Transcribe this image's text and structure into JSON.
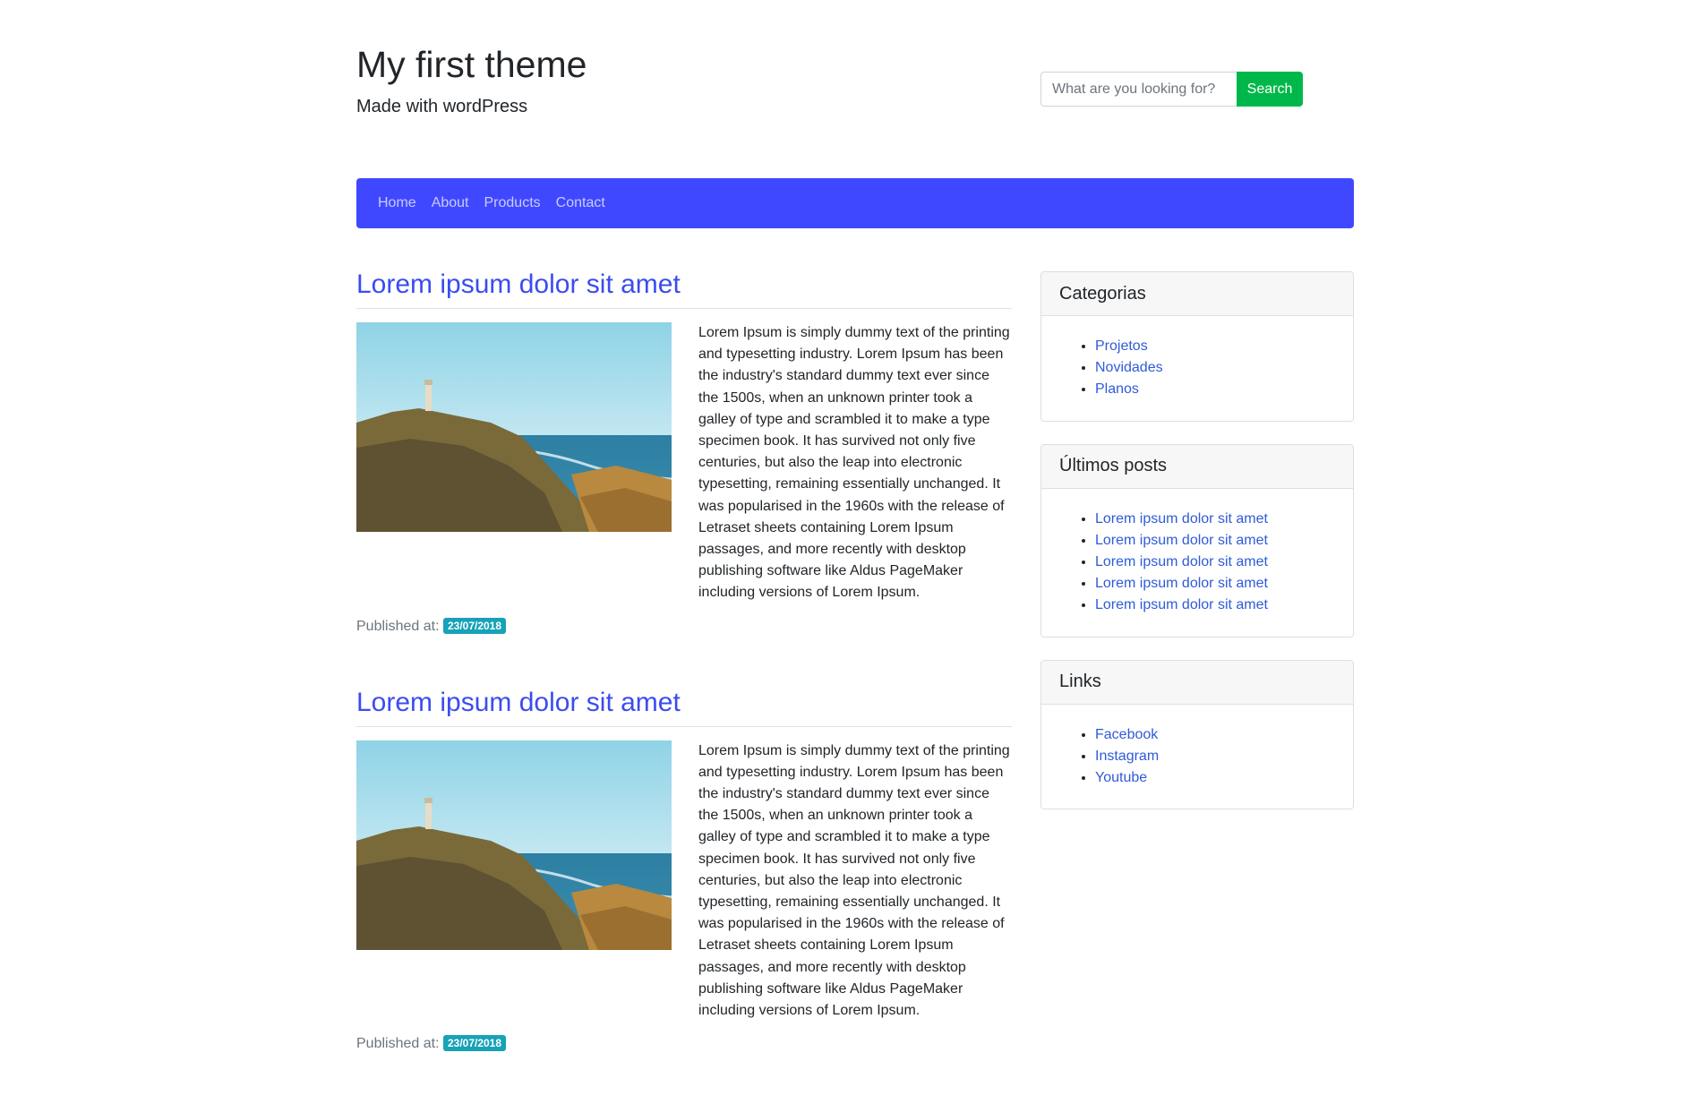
{
  "header": {
    "title": "My first theme",
    "subtitle": "Made with wordPress"
  },
  "search": {
    "placeholder": "What are you looking for?",
    "button_label": "Search"
  },
  "nav": {
    "items": [
      {
        "label": "Home"
      },
      {
        "label": "About"
      },
      {
        "label": "Products"
      },
      {
        "label": "Contact"
      }
    ]
  },
  "posts": [
    {
      "title": "Lorem ipsum dolor sit amet",
      "body": "Lorem Ipsum is simply dummy text of the printing and typesetting industry. Lorem Ipsum has been the industry's standard dummy text ever since the 1500s, when an unknown printer took a galley of type and scrambled it to make a type specimen book. It has survived not only five centuries, but also the leap into electronic typesetting, remaining essentially unchanged. It was popularised in the 1960s with the release of Letraset sheets containing Lorem Ipsum passages, and more recently with desktop publishing software like Aldus PageMaker including versions of Lorem Ipsum.",
      "published_label": "Published at:",
      "date": "23/07/2018"
    },
    {
      "title": "Lorem ipsum dolor sit amet",
      "body": "Lorem Ipsum is simply dummy text of the printing and typesetting industry. Lorem Ipsum has been the industry's standard dummy text ever since the 1500s, when an unknown printer took a galley of type and scrambled it to make a type specimen book. It has survived not only five centuries, but also the leap into electronic typesetting, remaining essentially unchanged. It was popularised in the 1960s with the release of Letraset sheets containing Lorem Ipsum passages, and more recently with desktop publishing software like Aldus PageMaker including versions of Lorem Ipsum.",
      "published_label": "Published at:",
      "date": "23/07/2018"
    }
  ],
  "sidebar": {
    "categories": {
      "title": "Categorias",
      "items": [
        {
          "label": "Projetos"
        },
        {
          "label": "Novidades"
        },
        {
          "label": "Planos"
        }
      ]
    },
    "latest": {
      "title": "Últimos posts",
      "items": [
        {
          "label": "Lorem ipsum dolor sit amet"
        },
        {
          "label": "Lorem ipsum dolor sit amet"
        },
        {
          "label": "Lorem ipsum dolor sit amet"
        },
        {
          "label": "Lorem ipsum dolor sit amet"
        },
        {
          "label": "Lorem ipsum dolor sit amet"
        }
      ]
    },
    "links": {
      "title": "Links",
      "items": [
        {
          "label": "Facebook"
        },
        {
          "label": "Instagram"
        },
        {
          "label": "Youtube"
        }
      ]
    }
  },
  "colors": {
    "navbar": "#4048ff",
    "search_button": "#00b84a",
    "post_title": "#3b4cf0",
    "badge": "#17a2b8",
    "link": "#2f5bd8"
  }
}
